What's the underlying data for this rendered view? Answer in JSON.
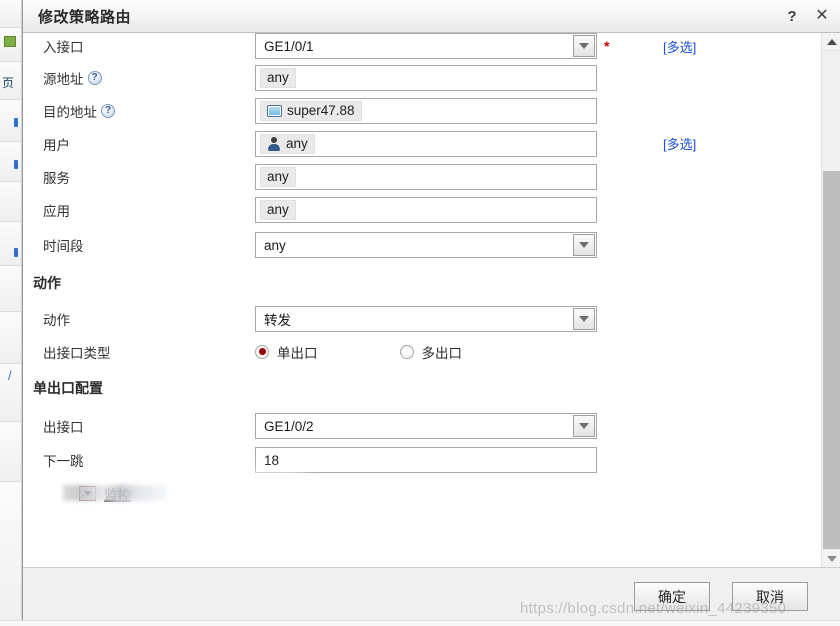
{
  "window": {
    "title": "修改策略路由",
    "help_icon": "question-mark-icon",
    "close_icon": "close-icon"
  },
  "form": {
    "rows": [
      {
        "label": "入接口",
        "value": "GE1/0/1",
        "kind": "select",
        "required_mark": "*",
        "multi_link": "[多选]"
      },
      {
        "label": "源地址",
        "help": "?",
        "value": "any",
        "kind": "chips"
      },
      {
        "label": "目的地址",
        "help": "?",
        "value": "super47.88",
        "kind": "chips",
        "chip_icon": "monitor-icon"
      },
      {
        "label": "用户",
        "value": "any",
        "kind": "chips",
        "chip_icon": "user-icon",
        "multi_link": "[多选]"
      },
      {
        "label": "服务",
        "value": "any",
        "kind": "chips"
      },
      {
        "label": "应用",
        "value": "any",
        "kind": "chips"
      },
      {
        "label": "时间段",
        "value": "any",
        "kind": "select"
      }
    ]
  },
  "action_section": {
    "title": "动作",
    "action": {
      "label": "动作",
      "value": "转发"
    },
    "egress_type": {
      "label": "出接口类型",
      "options": [
        {
          "label": "单出口",
          "selected": true
        },
        {
          "label": "多出口",
          "selected": false
        }
      ]
    }
  },
  "single_egress_section": {
    "title": "单出口配置",
    "egress_interface": {
      "label": "出接口",
      "value": "GE1/0/2"
    },
    "next_hop": {
      "label": "下一跳",
      "value": "18"
    },
    "monitor_toggle": {
      "label": "监控",
      "icon": "chevron-down-icon",
      "expanded": false
    }
  },
  "footer": {
    "ok_label": "确定",
    "cancel_label": "取消"
  },
  "watermark": {
    "text": "https://blog.csdn.net/weixin_44239350"
  },
  "colors": {
    "accent_link": "#1b4fd8",
    "required": "#d00000",
    "radio_selected": "#9b0000",
    "title_text": "#2a2a2a",
    "field_border": "#a8a8a8"
  }
}
